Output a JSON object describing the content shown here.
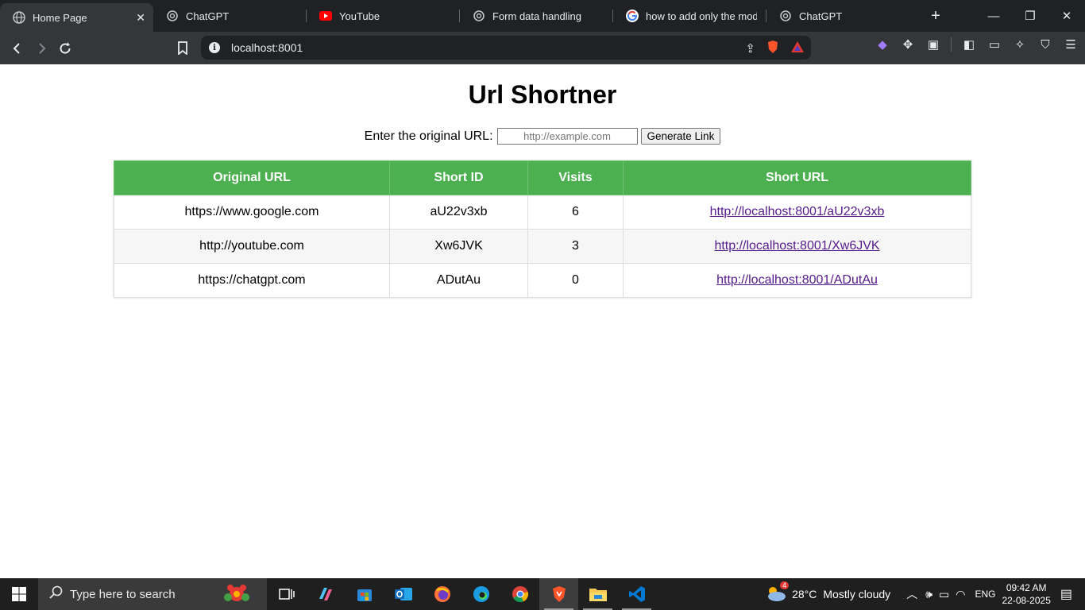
{
  "browser": {
    "tabs": [
      {
        "label": "Home Page",
        "active": true
      },
      {
        "label": "ChatGPT",
        "active": false
      },
      {
        "label": "YouTube",
        "active": false
      },
      {
        "label": "Form data handling",
        "active": false
      },
      {
        "label": "how to add only the modifi",
        "active": false
      },
      {
        "label": "ChatGPT",
        "active": false
      }
    ],
    "address": "localhost:8001"
  },
  "page": {
    "title": "Url Shortner",
    "form": {
      "label": "Enter the original URL:",
      "placeholder": "http://example.com",
      "button": "Generate Link"
    },
    "table": {
      "headers": [
        "Original URL",
        "Short ID",
        "Visits",
        "Short URL"
      ],
      "rows": [
        {
          "original": "https://www.google.com",
          "short_id": "aU22v3xb",
          "visits": "6",
          "short_url": "http://localhost:8001/aU22v3xb"
        },
        {
          "original": "http://youtube.com",
          "short_id": "Xw6JVK",
          "visits": "3",
          "short_url": "http://localhost:8001/Xw6JVK"
        },
        {
          "original": "https://chatgpt.com",
          "short_id": "ADutAu",
          "visits": "0",
          "short_url": "http://localhost:8001/ADutAu"
        }
      ]
    },
    "colors": {
      "header_bg": "#4caf50",
      "link": "#551a8b"
    }
  },
  "taskbar": {
    "search_placeholder": "Type here to search",
    "weather": {
      "temp": "28°C",
      "condition": "Mostly cloudy",
      "badge": "4"
    },
    "language": "ENG",
    "time": "09:42 AM",
    "date": "22-08-2025"
  }
}
